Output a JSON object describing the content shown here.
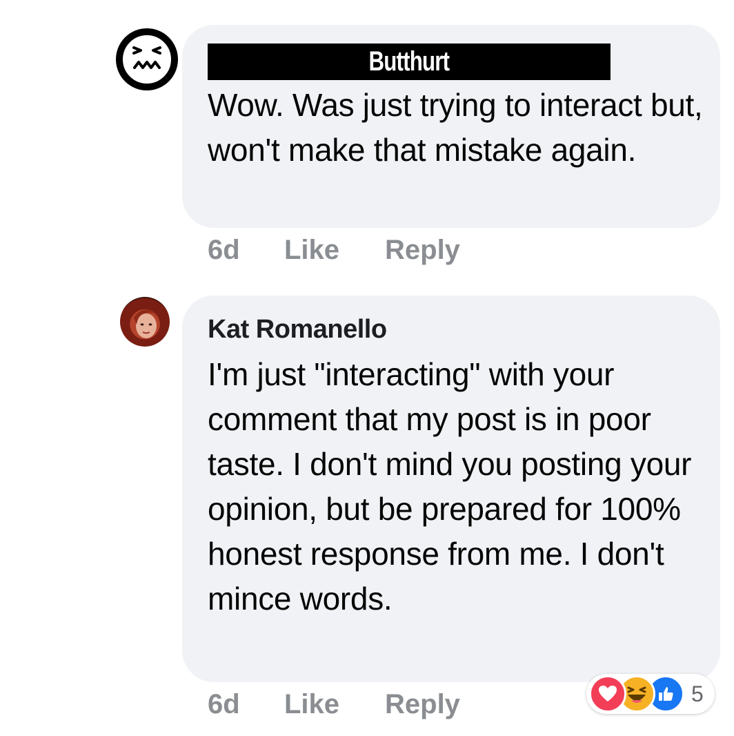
{
  "comments": [
    {
      "author": "Butthurt",
      "text": "Wow.  Was just trying to interact but, won't make that mistake again.",
      "time": "6d",
      "like_label": "Like",
      "reply_label": "Reply",
      "avatar_icon": "angry-face-icon"
    },
    {
      "author": "Kat Romanello",
      "text": "I'm just \"interacting\" with your comment that my post is in poor taste. I don't mind you posting your opinion, but be prepared for 100% honest response from me. I don't mince words.",
      "time": "6d",
      "like_label": "Like",
      "reply_label": "Reply",
      "avatar_icon": "profile-photo",
      "reactions": {
        "icons": [
          "love-reaction-icon",
          "haha-reaction-icon",
          "like-reaction-icon"
        ],
        "count": "5"
      }
    }
  ],
  "colors": {
    "bubble": "#f0f2f5",
    "meta_text": "#8a8d91",
    "love": "#f33e58",
    "haha": "#f7b125",
    "like": "#1877f2"
  }
}
